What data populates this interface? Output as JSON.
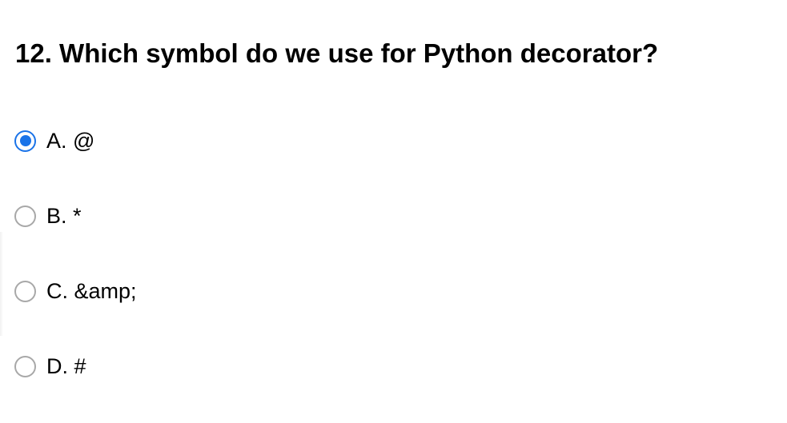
{
  "question": {
    "text": "12. Which symbol do we use for Python decorator?"
  },
  "options": [
    {
      "label": "A. @",
      "selected": true
    },
    {
      "label": "B. *",
      "selected": false
    },
    {
      "label": "C. &amp;",
      "selected": false
    },
    {
      "label": "D. #",
      "selected": false
    }
  ],
  "colors": {
    "selected_radio": "#1a73e8",
    "unselected_radio_border": "#a8a8a8"
  }
}
